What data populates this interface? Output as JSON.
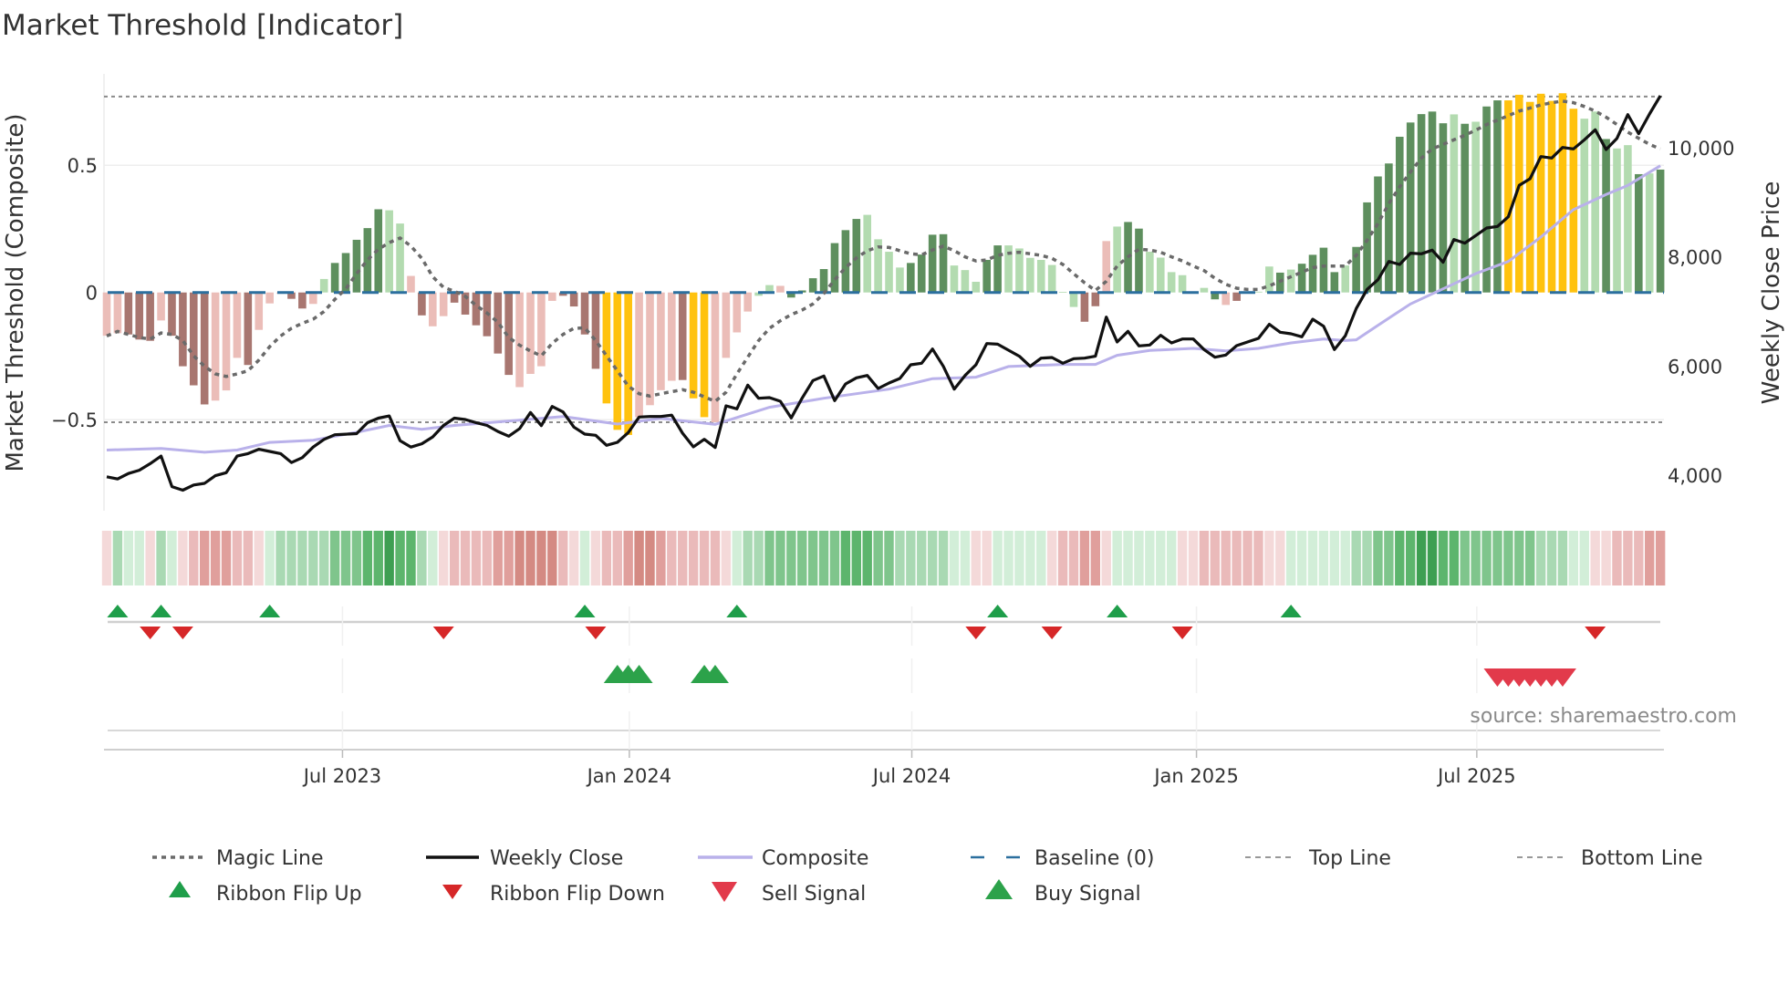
{
  "title": "Market Threshold [Indicator]",
  "source": "source: sharemaestro.com",
  "chart_data": {
    "type": "bar",
    "title": "Market Threshold [Indicator]",
    "ylabel_left": "Market Threshold (Composite)",
    "ylabel_right": "Weekly Close Price",
    "ylim_left": [
      -0.86,
      0.86
    ],
    "ylim_right": [
      3350,
      11400
    ],
    "left_ticks": [
      {
        "v": 0.5,
        "label": "0.5"
      },
      {
        "v": 0,
        "label": "0"
      },
      {
        "v": -0.5,
        "label": "−0.5"
      }
    ],
    "right_ticks": [
      {
        "v": 10000,
        "label": "10,000"
      },
      {
        "v": 8000,
        "label": "8,000"
      },
      {
        "v": 6000,
        "label": "6,000"
      },
      {
        "v": 4000,
        "label": "4,000"
      }
    ],
    "x_ticks": [
      {
        "week": 22.7,
        "label": "Jul 2023"
      },
      {
        "week": 49.1,
        "label": "Jan 2024"
      },
      {
        "week": 75.1,
        "label": "Jul 2024"
      },
      {
        "week": 101.3,
        "label": "Jan 2025"
      },
      {
        "week": 127.1,
        "label": "Jul 2025"
      }
    ],
    "top_line": 0.77,
    "bottom_line": -0.51,
    "baseline": 0,
    "grid": true,
    "bar_kind_legend": {
      "G": "strong positive",
      "g": "weak positive",
      "D": "strong negative",
      "L": "weak negative",
      "Y": "signal bar"
    },
    "composite_bars": [
      -0.17,
      -0.16,
      -0.165,
      -0.185,
      -0.19,
      -0.11,
      -0.17,
      -0.29,
      -0.365,
      -0.44,
      -0.425,
      -0.385,
      -0.257,
      -0.285,
      -0.147,
      -0.043,
      -0.005,
      -0.025,
      -0.063,
      -0.045,
      0.053,
      0.116,
      0.155,
      0.207,
      0.253,
      0.327,
      0.323,
      0.271,
      0.065,
      -0.09,
      -0.133,
      -0.093,
      -0.04,
      -0.087,
      -0.129,
      -0.172,
      -0.24,
      -0.324,
      -0.372,
      -0.32,
      -0.29,
      -0.033,
      -0.013,
      -0.055,
      -0.165,
      -0.3,
      -0.436,
      -0.54,
      -0.56,
      -0.49,
      -0.443,
      -0.384,
      -0.347,
      -0.344,
      -0.416,
      -0.49,
      -0.51,
      -0.257,
      -0.157,
      -0.075,
      -0.013,
      0.029,
      0.026,
      -0.02,
      0.008,
      0.056,
      0.092,
      0.194,
      0.245,
      0.289,
      0.305,
      0.209,
      0.16,
      0.098,
      0.116,
      0.149,
      0.227,
      0.229,
      0.106,
      0.088,
      0.042,
      0.128,
      0.185,
      0.185,
      0.173,
      0.136,
      0.128,
      0.108,
      0.002,
      -0.057,
      -0.115,
      -0.054,
      0.202,
      0.259,
      0.277,
      0.251,
      0.16,
      0.137,
      0.08,
      0.068,
      0.003,
      0.018,
      -0.027,
      -0.049,
      -0.033,
      0.002,
      0.003,
      0.102,
      0.078,
      0.09,
      0.113,
      0.148,
      0.176,
      0.08,
      0.106,
      0.179,
      0.354,
      0.456,
      0.507,
      0.612,
      0.668,
      0.701,
      0.711,
      0.665,
      0.7,
      0.663,
      0.671,
      0.731,
      0.755,
      0.755,
      0.777,
      0.749,
      0.781,
      0.753,
      0.783,
      0.722,
      0.683,
      0.711,
      0.603,
      0.566,
      0.579,
      0.465,
      0.468,
      0.483
    ],
    "bar_kinds": "LLDDDLDDDDLLLDLLLDDLgGGGGGggLDLLDDDDDDLLLLDDDDYYYLLLLDYYLLLLggLGGGGGGGggggGGGGgggGGgggggggDDLgGGggggggGLDLggGgGGGGgGGGGGGGGGgGgGGYYYYYYYggGggGgGG",
    "magic_line": [
      -0.171,
      -0.153,
      -0.165,
      -0.177,
      -0.183,
      -0.159,
      -0.165,
      -0.189,
      -0.249,
      -0.29,
      -0.32,
      -0.33,
      -0.32,
      -0.308,
      -0.266,
      -0.213,
      -0.171,
      -0.141,
      -0.121,
      -0.105,
      -0.075,
      -0.027,
      0.014,
      0.074,
      0.128,
      0.17,
      0.196,
      0.214,
      0.182,
      0.134,
      0.062,
      0.02,
      0.005,
      -0.015,
      -0.051,
      -0.081,
      -0.117,
      -0.177,
      -0.207,
      -0.23,
      -0.249,
      -0.2,
      -0.165,
      -0.141,
      -0.139,
      -0.189,
      -0.249,
      -0.308,
      -0.368,
      -0.398,
      -0.407,
      -0.398,
      -0.39,
      -0.382,
      -0.392,
      -0.41,
      -0.428,
      -0.392,
      -0.32,
      -0.254,
      -0.189,
      -0.141,
      -0.111,
      -0.087,
      -0.069,
      -0.045,
      -0.004,
      0.05,
      0.098,
      0.136,
      0.164,
      0.179,
      0.177,
      0.164,
      0.152,
      0.148,
      0.167,
      0.182,
      0.164,
      0.14,
      0.124,
      0.128,
      0.146,
      0.154,
      0.158,
      0.152,
      0.146,
      0.134,
      0.11,
      0.074,
      0.038,
      0.008,
      0.044,
      0.104,
      0.14,
      0.17,
      0.167,
      0.158,
      0.14,
      0.124,
      0.104,
      0.086,
      0.056,
      0.032,
      0.017,
      0.012,
      0.012,
      0.026,
      0.044,
      0.062,
      0.08,
      0.098,
      0.104,
      0.104,
      0.104,
      0.146,
      0.205,
      0.271,
      0.349,
      0.415,
      0.474,
      0.528,
      0.564,
      0.582,
      0.6,
      0.618,
      0.638,
      0.66,
      0.677,
      0.695,
      0.713,
      0.725,
      0.737,
      0.746,
      0.752,
      0.746,
      0.731,
      0.713,
      0.689,
      0.66,
      0.63,
      0.606,
      0.582,
      0.564
    ],
    "weekly_close": [
      3970,
      3930,
      4030,
      4090,
      4210,
      4350,
      3790,
      3725,
      3820,
      3850,
      3990,
      4045,
      4350,
      4395,
      4475,
      4435,
      4395,
      4230,
      4320,
      4515,
      4655,
      4740,
      4750,
      4760,
      4960,
      5045,
      5085,
      4630,
      4515,
      4575,
      4700,
      4910,
      5045,
      5020,
      4960,
      4910,
      4800,
      4713,
      4852,
      5148,
      4908,
      5258,
      5158,
      4880,
      4752,
      4730,
      4546,
      4602,
      4780,
      5064,
      5075,
      5075,
      5100,
      4769,
      4518,
      4657,
      4507,
      5270,
      5215,
      5649,
      5409,
      5420,
      5353,
      5047,
      5409,
      5733,
      5816,
      5365,
      5671,
      5783,
      5827,
      5588,
      5688,
      5771,
      6022,
      6050,
      6311,
      5994,
      5576,
      5827,
      6022,
      6411,
      6400,
      6289,
      6178,
      5994,
      6144,
      6155,
      6050,
      6133,
      6144,
      6178,
      6896,
      6440,
      6635,
      6368,
      6384,
      6562,
      6423,
      6495,
      6495,
      6300,
      6161,
      6200,
      6373,
      6440,
      6507,
      6763,
      6618,
      6590,
      6535,
      6857,
      6729,
      6300,
      6551,
      7052,
      7404,
      7581,
      7915,
      7860,
      8066,
      8055,
      8122,
      7899,
      8317,
      8250,
      8390,
      8528,
      8556,
      8734,
      9309,
      9431,
      9837,
      9810,
      10004,
      9976,
      10144,
      10327,
      9965,
      10171,
      10605,
      10255,
      10617,
      10951
    ],
    "composite_line": [
      [
        1,
        4460
      ],
      [
        6,
        4490
      ],
      [
        10,
        4420
      ],
      [
        13,
        4460
      ],
      [
        16,
        4600
      ],
      [
        20,
        4640
      ],
      [
        24,
        4785
      ],
      [
        27,
        4910
      ],
      [
        30,
        4840
      ],
      [
        33,
        4910
      ],
      [
        37,
        4975
      ],
      [
        43,
        5075
      ],
      [
        48,
        4935
      ],
      [
        52,
        5040
      ],
      [
        57,
        4930
      ],
      [
        62,
        5243
      ],
      [
        67,
        5409
      ],
      [
        73,
        5576
      ],
      [
        77,
        5767
      ],
      [
        81,
        5795
      ],
      [
        84,
        5990
      ],
      [
        89,
        6028
      ],
      [
        92,
        6028
      ],
      [
        94,
        6195
      ],
      [
        97,
        6284
      ],
      [
        101,
        6323
      ],
      [
        104,
        6278
      ],
      [
        107,
        6323
      ],
      [
        110,
        6423
      ],
      [
        113,
        6495
      ],
      [
        115,
        6467
      ],
      [
        116,
        6480
      ],
      [
        118,
        6746
      ],
      [
        121,
        7136
      ],
      [
        124,
        7414
      ],
      [
        127,
        7693
      ],
      [
        130,
        7915
      ],
      [
        133,
        8362
      ],
      [
        136,
        8863
      ],
      [
        139,
        9142
      ],
      [
        141,
        9309
      ],
      [
        144,
        9670
      ]
    ],
    "ribbon": [
      -1,
      2,
      1,
      1,
      -1,
      2,
      1,
      -1,
      -2,
      -3,
      -3,
      -3,
      -2,
      -2,
      -1,
      1,
      2,
      2,
      2,
      2,
      2,
      3,
      3,
      3,
      4,
      4,
      5,
      4,
      4,
      2,
      1,
      -1,
      -2,
      -2,
      -2,
      -2,
      -3,
      -3,
      -4,
      -4,
      -4,
      -4,
      -2,
      -1,
      1,
      -1,
      -2,
      -2,
      -3,
      -4,
      -4,
      -3,
      -2,
      -2,
      -2,
      -2,
      -2,
      -1,
      1,
      2,
      2,
      3,
      3,
      3,
      3,
      3,
      3,
      3,
      4,
      4,
      4,
      3,
      3,
      2,
      2,
      2,
      2,
      2,
      1,
      1,
      -1,
      -1,
      1,
      1,
      1,
      1,
      1,
      -1,
      -2,
      -2,
      -3,
      -3,
      -1,
      1,
      1,
      1,
      1,
      1,
      1,
      -1,
      -1,
      -2,
      -2,
      -2,
      -2,
      -2,
      -2,
      -1,
      -1,
      1,
      1,
      1,
      1,
      1,
      1,
      2,
      2,
      3,
      3,
      4,
      4,
      5,
      5,
      4,
      4,
      3,
      3,
      3,
      3,
      3,
      3,
      3,
      2,
      2,
      2,
      1,
      1,
      -1,
      -1,
      -2,
      -2,
      -2,
      -3,
      -3
    ],
    "ribbon_flip_up": [
      2,
      6,
      16,
      45,
      59,
      83,
      94,
      110
    ],
    "ribbon_flip_down": [
      5,
      8,
      32,
      46,
      81,
      88,
      100,
      138
    ],
    "buy_signals": [
      48,
      49,
      50,
      56,
      57
    ],
    "sell_signals": [
      129,
      130,
      131,
      132,
      133,
      134,
      135
    ],
    "legend": [
      {
        "label": "Magic Line",
        "kind": "dotted"
      },
      {
        "label": "Weekly Close",
        "kind": "solid-black"
      },
      {
        "label": "Composite",
        "kind": "solid-lavender"
      },
      {
        "label": "Baseline (0)",
        "kind": "dashed-blue"
      },
      {
        "label": "Top Line",
        "kind": "dash-gray"
      },
      {
        "label": "Bottom Line",
        "kind": "dash-gray"
      },
      {
        "label": "Ribbon Flip Up",
        "kind": "tri-up-green"
      },
      {
        "label": "Ribbon Flip Down",
        "kind": "tri-down-red"
      },
      {
        "label": "Sell Signal",
        "kind": "tri-down-red-large"
      },
      {
        "label": "Buy Signal",
        "kind": "tri-up-green-large"
      }
    ],
    "legend_placement": "bottom"
  },
  "colors": {
    "bar_G": "#5e8f5e",
    "bar_g": "#b3dbb0",
    "bar_D": "#a87670",
    "bar_L": "#ebbdb8",
    "bar_Y": "#ffc20e",
    "magic": "#6a6a6a",
    "close": "#111111",
    "composite": "#b9b1ea",
    "baseline": "#2b6f9e",
    "threshold": "#8a8a8a",
    "flip_up": "#1f9e4a",
    "flip_down": "#d62728",
    "sell": "#e23a4b",
    "buy": "#2ca24a",
    "ribbon_pos": [
      "#d2eed8",
      "#a9d9b3",
      "#7fc58c",
      "#5db56d",
      "#3e9f52"
    ],
    "ribbon_neg": [
      "#f4d9d9",
      "#eababa",
      "#e09f9c",
      "#d48a83"
    ]
  }
}
